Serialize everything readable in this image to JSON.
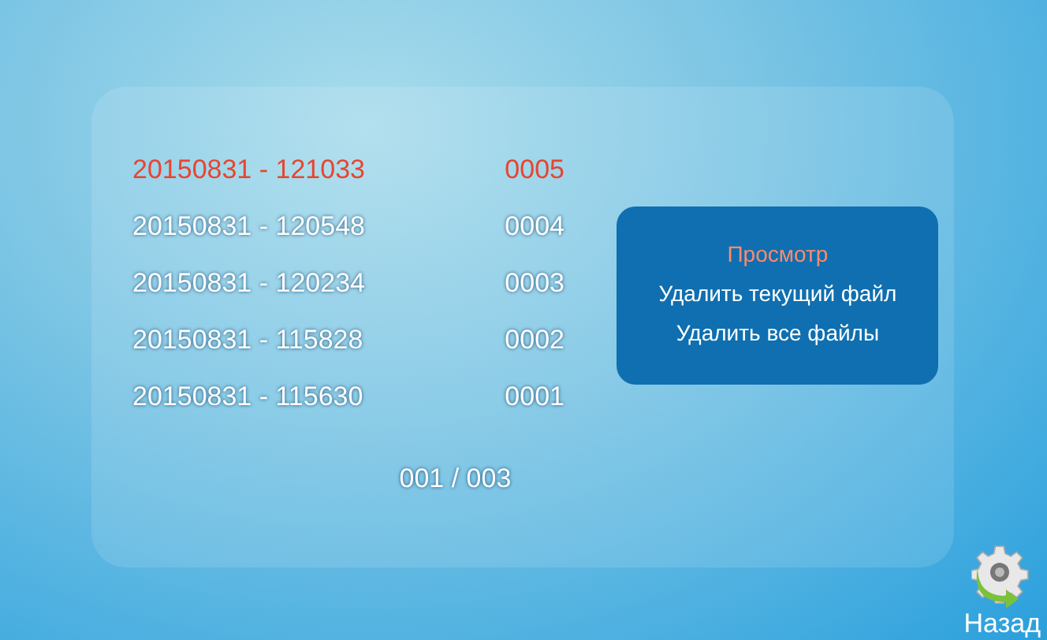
{
  "files": [
    {
      "name": "20150831 - 121033",
      "number": "0005",
      "selected": true
    },
    {
      "name": "20150831 - 120548",
      "number": "0004",
      "selected": false
    },
    {
      "name": "20150831 - 120234",
      "number": "0003",
      "selected": false
    },
    {
      "name": "20150831 - 115828",
      "number": "0002",
      "selected": false
    },
    {
      "name": "20150831 - 115630",
      "number": "0001",
      "selected": false
    }
  ],
  "pager": "001 / 003",
  "menu": [
    {
      "label": "Просмотр",
      "selected": true
    },
    {
      "label": "Удалить текущий файл",
      "selected": false
    },
    {
      "label": "Удалить все файлы",
      "selected": false
    }
  ],
  "back_button": {
    "label": "Назад"
  }
}
